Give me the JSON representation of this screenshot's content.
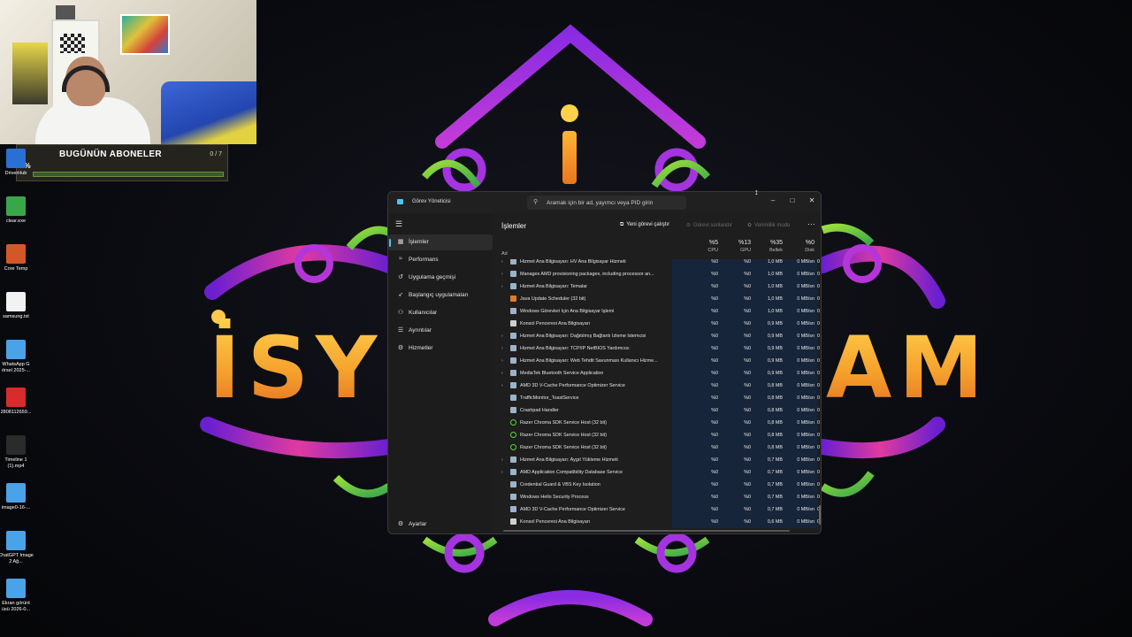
{
  "wallpaper": {
    "letters_left": "İSY",
    "letters_right": "AM"
  },
  "subscriber_widget": {
    "title": "BUGÜNÜN ABONELER",
    "count": "0 / 7",
    "percent": "0%",
    "progress_fraction": 0
  },
  "desktop_icons": [
    {
      "label": "DriverHub",
      "icon": "app-icon",
      "color": "#2a6fd6"
    },
    {
      "label": "clear.exe",
      "icon": "ram-icon",
      "color": "#3aa64a"
    },
    {
      "label": "Core Temp",
      "icon": "core-temp-icon",
      "color": "#d4572a"
    },
    {
      "label": "samsung.txt",
      "icon": "text-file-icon",
      "color": "#f2f2f2"
    },
    {
      "label": "WhatsApp G örsel 2025-...",
      "icon": "image-file-icon",
      "color": "#4aa3e8"
    },
    {
      "label": "2808112659...",
      "icon": "pdf-icon",
      "color": "#d82b2b"
    },
    {
      "label": "Timeline 1 (1).mp4",
      "icon": "video-icon",
      "color": "#2b2b2b"
    },
    {
      "label": "image0-16-...",
      "icon": "image-file-icon",
      "color": "#4aa3e8"
    },
    {
      "label": "ChatGPT Image 2 Ağ...",
      "icon": "image-file-icon",
      "color": "#4aa3e8"
    },
    {
      "label": "Ekran görünt üsü 2026-0...",
      "icon": "image-file-icon",
      "color": "#4aa3e8"
    }
  ],
  "task_manager": {
    "app_title": "Görev Yöneticisi",
    "search_placeholder": "Aramak için bir ad, yayımcı veya PID girin",
    "nav": [
      {
        "label": "İşlemler",
        "icon": "grid-icon",
        "active": true
      },
      {
        "label": "Performans",
        "icon": "performance-icon",
        "active": false
      },
      {
        "label": "Uygulama geçmişi",
        "icon": "history-icon",
        "active": false
      },
      {
        "label": "Başlangıç uygulamaları",
        "icon": "startup-icon",
        "active": false
      },
      {
        "label": "Kullanıcılar",
        "icon": "users-icon",
        "active": false
      },
      {
        "label": "Ayrıntılar",
        "icon": "details-icon",
        "active": false
      },
      {
        "label": "Hizmetler",
        "icon": "services-icon",
        "active": false
      }
    ],
    "settings_label": "Ayarlar",
    "page_title": "İşlemler",
    "toolbar": {
      "run_new_task": "Yeni görevi çalıştır",
      "end_task": "Görevi sonlandır",
      "efficiency_mode": "Verimlilik modu"
    },
    "columns": {
      "name": "Ad",
      "cpu": {
        "value": "%5",
        "label": "CPU"
      },
      "gpu": {
        "value": "%13",
        "label": "GPU"
      },
      "memory": {
        "value": "%35",
        "label": "Bellek"
      },
      "disk": {
        "value": "%0",
        "label": "Disk"
      }
    },
    "rows": [
      {
        "name": "Hizmet Ana Bilgisayarı: HV Ana Bilgisayar Hizmeti",
        "expand": true,
        "icon": "svc",
        "cpu": "%0",
        "gpu": "%0",
        "mem": "1,0 MB",
        "disk": "0 MB/sn",
        "net": "0"
      },
      {
        "name": "Manages AMD provisioning packages, including processor an...",
        "expand": true,
        "icon": "svc",
        "cpu": "%0",
        "gpu": "%0",
        "mem": "1,0 MB",
        "disk": "0 MB/sn",
        "net": "0"
      },
      {
        "name": "Hizmet Ana Bilgisayarı: Temalar",
        "expand": true,
        "icon": "svc",
        "cpu": "%0",
        "gpu": "%0",
        "mem": "1,0 MB",
        "disk": "0 MB/sn",
        "net": "0"
      },
      {
        "name": "Java Update Scheduler (32 bit)",
        "expand": false,
        "icon": "java",
        "cpu": "%0",
        "gpu": "%0",
        "mem": "1,0 MB",
        "disk": "0 MB/sn",
        "net": "0"
      },
      {
        "name": "Windows Görevleri İçin Ana Bilgisayar İşlemi",
        "expand": false,
        "icon": "svc",
        "cpu": "%0",
        "gpu": "%0",
        "mem": "1,0 MB",
        "disk": "0 MB/sn",
        "net": "0"
      },
      {
        "name": "Konsol Penceresi Ana Bilgisayarı",
        "expand": false,
        "icon": "console",
        "cpu": "%0",
        "gpu": "%0",
        "mem": "0,9 MB",
        "disk": "0 MB/sn",
        "net": "0"
      },
      {
        "name": "Hizmet Ana Bilgisayarı: Dağıtılmış Bağlantı İzleme İstemcisi",
        "expand": true,
        "icon": "svc",
        "cpu": "%0",
        "gpu": "%0",
        "mem": "0,9 MB",
        "disk": "0 MB/sn",
        "net": "0"
      },
      {
        "name": "Hizmet Ana Bilgisayarı: TCP/IP NetBIOS Yardımcısı",
        "expand": true,
        "icon": "svc",
        "cpu": "%0",
        "gpu": "%0",
        "mem": "0,9 MB",
        "disk": "0 MB/sn",
        "net": "0"
      },
      {
        "name": "Hizmet Ana Bilgisayarı: Web Tehdit Savunması Kullanıcı Hizme...",
        "expand": true,
        "icon": "svc",
        "cpu": "%0",
        "gpu": "%0",
        "mem": "0,9 MB",
        "disk": "0 MB/sn",
        "net": "0"
      },
      {
        "name": "MediaTek Bluetooth Service Application",
        "expand": true,
        "icon": "svc",
        "cpu": "%0",
        "gpu": "%0",
        "mem": "0,9 MB",
        "disk": "0 MB/sn",
        "net": "0"
      },
      {
        "name": "AMD 3D V-Cache Performance Optimizer Service",
        "expand": true,
        "icon": "svc",
        "cpu": "%0",
        "gpu": "%0",
        "mem": "0,8 MB",
        "disk": "0 MB/sn",
        "net": "0"
      },
      {
        "name": "TrafficMonitor_ToastService",
        "expand": false,
        "icon": "svc",
        "cpu": "%0",
        "gpu": "%0",
        "mem": "0,8 MB",
        "disk": "0 MB/sn",
        "net": "0"
      },
      {
        "name": "Crashpad Handler",
        "expand": false,
        "icon": "svc",
        "cpu": "%0",
        "gpu": "%0",
        "mem": "0,8 MB",
        "disk": "0 MB/sn",
        "net": "0"
      },
      {
        "name": "Razer Chroma SDK Service Host (32 bit)",
        "expand": false,
        "icon": "razer",
        "cpu": "%0",
        "gpu": "%0",
        "mem": "0,8 MB",
        "disk": "0 MB/sn",
        "net": "0"
      },
      {
        "name": "Razer Chroma SDK Service Host (32 bit)",
        "expand": false,
        "icon": "razer",
        "cpu": "%0",
        "gpu": "%0",
        "mem": "0,8 MB",
        "disk": "0 MB/sn",
        "net": "0"
      },
      {
        "name": "Razer Chroma SDK Service Host (32 bit)",
        "expand": false,
        "icon": "razer",
        "cpu": "%0",
        "gpu": "%0",
        "mem": "0,8 MB",
        "disk": "0 MB/sn",
        "net": "0"
      },
      {
        "name": "Hizmet Ana Bilgisayarı: Aygıt Yükleme Hizmeti",
        "expand": true,
        "icon": "svc",
        "cpu": "%0",
        "gpu": "%0",
        "mem": "0,7 MB",
        "disk": "0 MB/sn",
        "net": "0"
      },
      {
        "name": "AMD Application Compatibility Database Service",
        "expand": true,
        "icon": "svc",
        "cpu": "%0",
        "gpu": "%0",
        "mem": "0,7 MB",
        "disk": "0 MB/sn",
        "net": "0"
      },
      {
        "name": "Credential Guard & VBS Key Isolation",
        "expand": false,
        "icon": "svc",
        "cpu": "%0",
        "gpu": "%0",
        "mem": "0,7 MB",
        "disk": "0 MB/sn",
        "net": "0"
      },
      {
        "name": "Windows Hello Security Process",
        "expand": false,
        "icon": "svc",
        "cpu": "%0",
        "gpu": "%0",
        "mem": "0,7 MB",
        "disk": "0 MB/sn",
        "net": "0"
      },
      {
        "name": "AMD 3D V-Cache Performance Optimizer Service",
        "expand": false,
        "icon": "svc",
        "cpu": "%0",
        "gpu": "%0",
        "mem": "0,7 MB",
        "disk": "0 MB/sn",
        "net": "0"
      },
      {
        "name": "Konsol Penceresi Ana Bilgisayarı",
        "expand": false,
        "icon": "console",
        "cpu": "%0",
        "gpu": "%0",
        "mem": "0,6 MB",
        "disk": "0 MB/sn",
        "net": "0"
      }
    ]
  },
  "colors": {
    "accent": "#4cc2ff",
    "heatmap": "#16253a",
    "logo_gold": "#ffb534",
    "logo_purple": "#9b2ce0",
    "logo_magenta": "#d83aa8"
  }
}
